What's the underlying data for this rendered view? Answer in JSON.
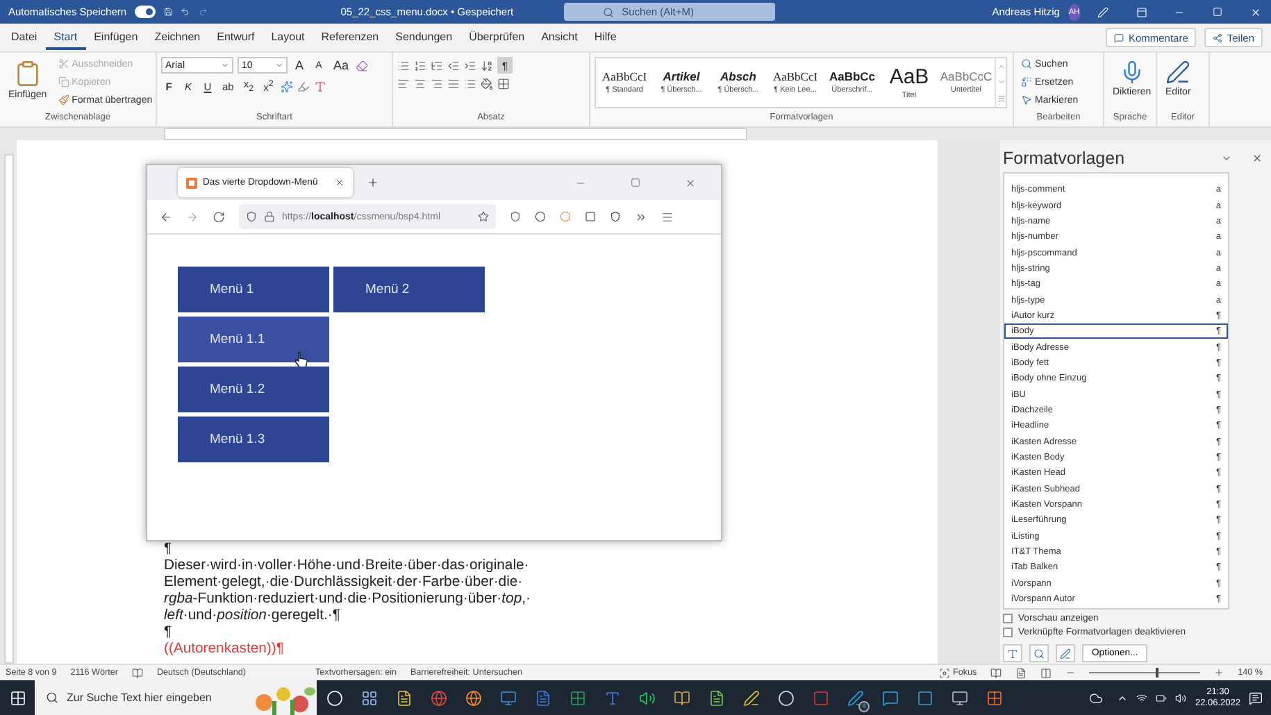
{
  "titlebar": {
    "autosave_label": "Automatisches Speichern",
    "autosave_on": true,
    "document": "05_22_css_menu.docx • Gespeichert",
    "search_placeholder": "Suchen (Alt+M)",
    "user": "Andreas Hitzig",
    "avatar": "AH"
  },
  "ribbon_tabs": [
    {
      "label": "Datei",
      "selected": false
    },
    {
      "label": "Start",
      "selected": true
    },
    {
      "label": "Einfügen",
      "selected": false
    },
    {
      "label": "Zeichnen",
      "selected": false
    },
    {
      "label": "Entwurf",
      "selected": false
    },
    {
      "label": "Layout",
      "selected": false
    },
    {
      "label": "Referenzen",
      "selected": false
    },
    {
      "label": "Sendungen",
      "selected": false
    },
    {
      "label": "Überprüfen",
      "selected": false
    },
    {
      "label": "Ansicht",
      "selected": false
    },
    {
      "label": "Hilfe",
      "selected": false
    }
  ],
  "share_buttons": [
    "Kommentare",
    "Teilen"
  ],
  "clipboard": {
    "paste": "Einfügen",
    "group": "Zwischenablage",
    "actions": [
      {
        "label": "Ausschneiden",
        "disabled": true
      },
      {
        "label": "Kopieren",
        "disabled": true
      },
      {
        "label": "Format übertragen",
        "disabled": false
      }
    ]
  },
  "font": {
    "name": "Arial",
    "size": "10",
    "group": "Schriftart",
    "size_keys": [
      "A",
      "A",
      "Aa"
    ],
    "format_keys": [
      "F",
      "K",
      "U",
      "ab",
      "x$_{2}$",
      "x$^{2}$"
    ]
  },
  "paragraph": {
    "group": "Absatz",
    "marks_key": "¶",
    "marks_on": true
  },
  "styles_gallery": {
    "group": "Formatvorlagen",
    "items": [
      {
        "preview": "AaBbCcI",
        "label": "¶ Standard",
        "kind": "plain"
      },
      {
        "preview": "Artikel",
        "label": "¶ Übersch...",
        "kind": "bolditalic"
      },
      {
        "preview": "Absch",
        "label": "¶ Übersch...",
        "kind": "bolditalic"
      },
      {
        "preview": "AaBbCcI",
        "label": "¶ Kein Lee...",
        "kind": "plain"
      },
      {
        "preview": "AaBbCc",
        "label": "Überschrif...",
        "kind": "bold"
      },
      {
        "preview": "AaB",
        "label": "Titel",
        "kind": "title"
      },
      {
        "preview": "AaBbCcC",
        "label": "Untertitel",
        "kind": "subtle"
      }
    ]
  },
  "editing": {
    "group": "Bearbeiten",
    "items": [
      "Suchen",
      "Ersetzen",
      "Markieren"
    ]
  },
  "voice": {
    "button": "Diktieren",
    "group": "Sprache"
  },
  "editor": {
    "button": "Editor",
    "group": "Editor"
  },
  "browser": {
    "tab": "Das vierte Dropdown-Menü",
    "url": "https://**localhost**/cssmenu/bsp4.html",
    "menus": [
      {
        "label": "Menü 1",
        "children": [
          {
            "label": "Menü 1.1",
            "hovered": true
          },
          {
            "label": "Menü 1.2",
            "hovered": false
          },
          {
            "label": "Menü 1.3",
            "hovered": false
          }
        ]
      },
      {
        "label": "Menü 2"
      }
    ]
  },
  "document": {
    "paragraphs": [
      {
        "kind": "mark",
        "lines": [
          "¶"
        ]
      },
      {
        "kind": "body",
        "lines": [
          "Dieser·wird·in·voller·Höhe·und·Breite·über·das·originale·",
          "Element·gelegt,·die·Durchlässigkeit·der·Farbe·über·die·",
          "*rgba*-Funktion·reduziert·und·die·Positionierung·über·*top*,·",
          "*left*·und·*position*·geregelt.·¶"
        ]
      },
      {
        "kind": "mark",
        "lines": [
          "¶"
        ]
      },
      {
        "kind": "placeholder",
        "lines": [
          "((Autorenkasten))¶"
        ]
      }
    ]
  },
  "styles_pane": {
    "title": "Formatvorlagen",
    "items": [
      {
        "name": "hljs-comment",
        "marker": "a",
        "selected": false
      },
      {
        "name": "hljs-keyword",
        "marker": "a",
        "selected": false
      },
      {
        "name": "hljs-name",
        "marker": "a",
        "selected": false
      },
      {
        "name": "hljs-number",
        "marker": "a",
        "selected": false
      },
      {
        "name": "hljs-pscommand",
        "marker": "a",
        "selected": false
      },
      {
        "name": "hljs-string",
        "marker": "a",
        "selected": false
      },
      {
        "name": "hljs-tag",
        "marker": "a",
        "selected": false
      },
      {
        "name": "hljs-type",
        "marker": "a",
        "selected": false
      },
      {
        "name": "iAutor kurz",
        "marker": "¶",
        "selected": false
      },
      {
        "name": "iBody",
        "marker": "¶",
        "selected": true
      },
      {
        "name": "iBody Adresse",
        "marker": "¶",
        "selected": false
      },
      {
        "name": "iBody fett",
        "marker": "¶",
        "selected": false
      },
      {
        "name": "iBody ohne Einzug",
        "marker": "¶",
        "selected": false
      },
      {
        "name": "iBU",
        "marker": "¶",
        "selected": false
      },
      {
        "name": "iDachzeile",
        "marker": "¶",
        "selected": false
      },
      {
        "name": "iHeadline",
        "marker": "¶",
        "selected": false
      },
      {
        "name": "iKasten Adresse",
        "marker": "¶",
        "selected": false
      },
      {
        "name": "iKasten Body",
        "marker": "¶",
        "selected": false
      },
      {
        "name": "iKasten Head",
        "marker": "¶",
        "selected": false
      },
      {
        "name": "iKasten Subhead",
        "marker": "¶",
        "selected": false
      },
      {
        "name": "iKasten Vorspann",
        "marker": "¶",
        "selected": false
      },
      {
        "name": "iLeserführung",
        "marker": "¶",
        "selected": false
      },
      {
        "name": "iListing",
        "marker": "¶",
        "selected": false
      },
      {
        "name": "IT&T Thema",
        "marker": "¶",
        "selected": false
      },
      {
        "name": "iTab Balken",
        "marker": "¶",
        "selected": false
      },
      {
        "name": "iVorspann",
        "marker": "¶",
        "selected": false
      },
      {
        "name": "iVorspann Autor",
        "marker": "¶",
        "selected": false
      }
    ],
    "options": [
      {
        "label": "Vorschau anzeigen",
        "checked": false
      },
      {
        "label": "Verknüpfte Formatvorlagen deaktivieren",
        "checked": false
      }
    ],
    "options_button": "Optionen..."
  },
  "status_bar": {
    "page": "Seite 8 von 9",
    "words": "2116 Wörter",
    "language": "Deutsch (Deutschland)",
    "prediction": "Textvorhersagen: ein",
    "accessibility": "Barrierefreiheit: Untersuchen",
    "focus": "Fokus",
    "zoom": "140 %",
    "level": 0.6
  },
  "taskbar": {
    "search_placeholder": "Zur Suche Text hier eingeben",
    "badge": "4",
    "time": "21:30",
    "date": "22.06.2022"
  }
}
